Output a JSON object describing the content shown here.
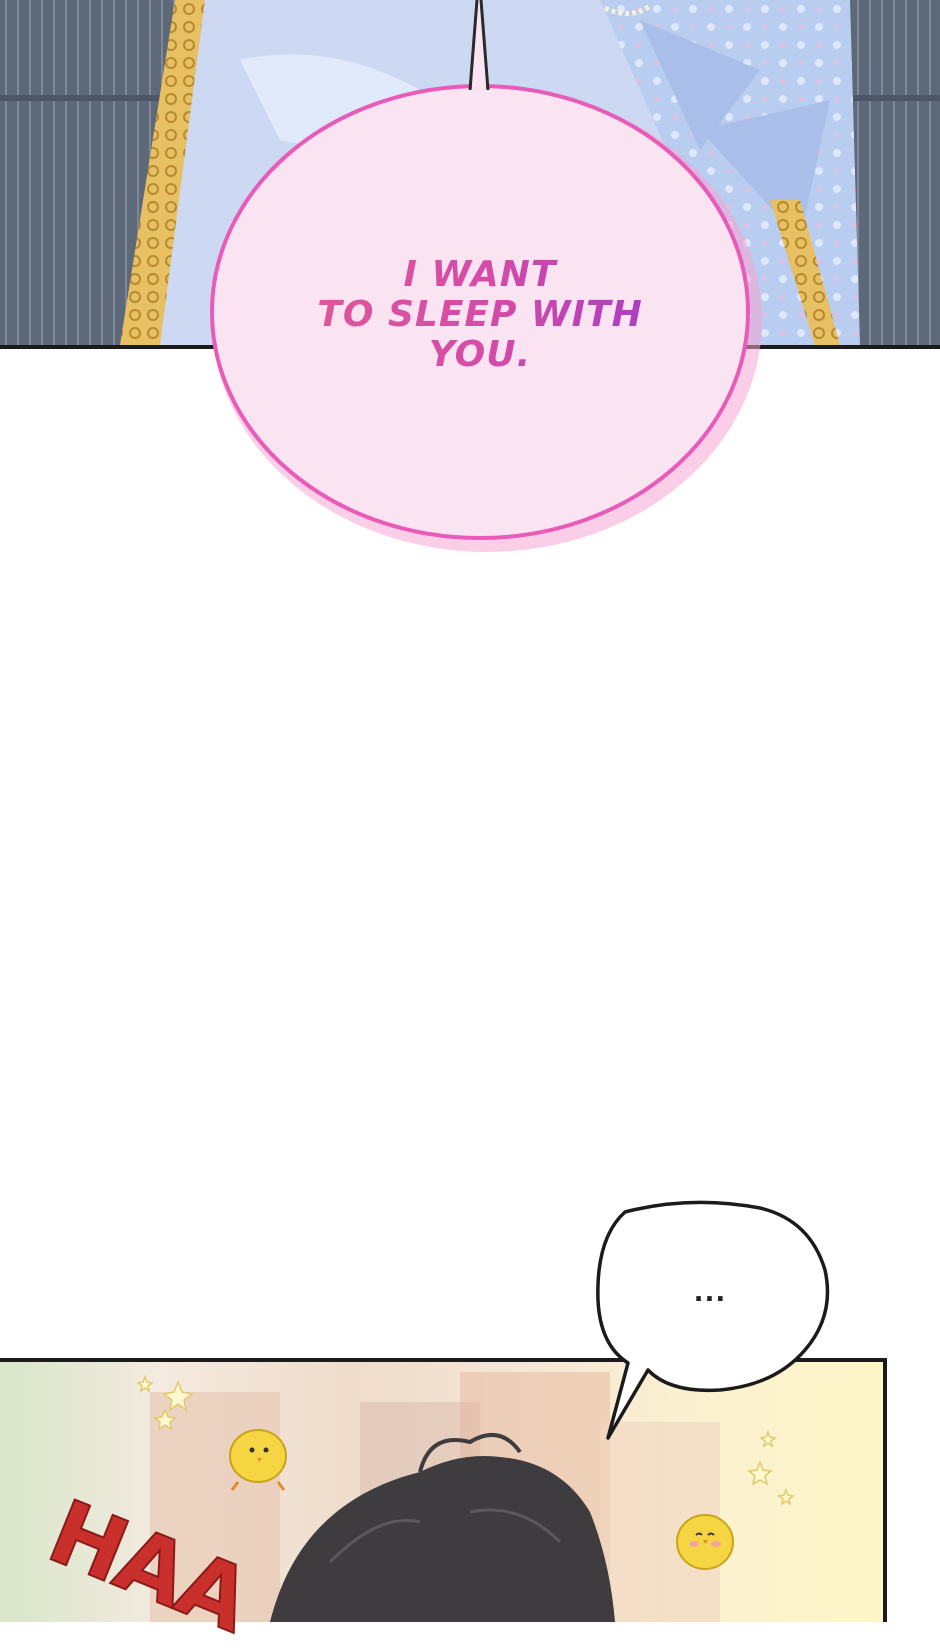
{
  "panels": {
    "top": {
      "bubble_text": "I WANT\nTO SLEEP WITH\nYOU."
    },
    "bottom": {
      "speech_text": "...",
      "sfx_text": "HAA"
    }
  },
  "colors": {
    "pink_bubble_fill": "#fce9f4",
    "pink_bubble_border": "#e85bb8",
    "text_pink": "#e0579a",
    "text_purple": "#a83cc7",
    "sfx_red": "#c9302c"
  },
  "icons": [
    "chick-icon",
    "sparkle-icon"
  ]
}
